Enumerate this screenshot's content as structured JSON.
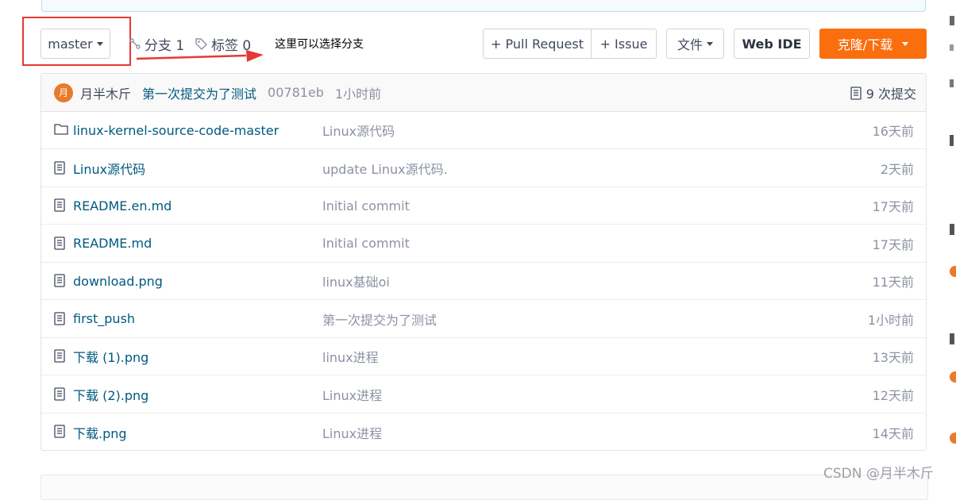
{
  "toolbar": {
    "branch": "master",
    "branches_label": "分支 1",
    "tags_label": "标签 0",
    "annotation": "这里可以选择分支",
    "pull_request": "+ Pull Request",
    "issue": "+ Issue",
    "file_menu": "文件",
    "web_ide": "Web IDE",
    "clone": "克隆/下载"
  },
  "commit": {
    "avatar_letter": "月",
    "author": "月半木斤",
    "message": "第一次提交为了测试",
    "hash": "00781eb",
    "time": "1小时前",
    "count": "9 次提交"
  },
  "files": [
    {
      "type": "folder",
      "name": "linux-kernel-source-code-master",
      "message": "Linux源代码",
      "time": "16天前"
    },
    {
      "type": "file",
      "name": "Linux源代码",
      "message": "update Linux源代码.",
      "time": "2天前"
    },
    {
      "type": "file",
      "name": "README.en.md",
      "message": "Initial commit",
      "time": "17天前"
    },
    {
      "type": "file",
      "name": "README.md",
      "message": "Initial commit",
      "time": "17天前"
    },
    {
      "type": "file",
      "name": "download.png",
      "message": "linux基础oi",
      "time": "11天前"
    },
    {
      "type": "file",
      "name": "first_push",
      "message": "第一次提交为了测试",
      "time": "1小时前"
    },
    {
      "type": "file",
      "name": "下载 (1).png",
      "message": "linux进程",
      "time": "13天前"
    },
    {
      "type": "file",
      "name": "下载 (2).png",
      "message": "Linux进程",
      "time": "12天前"
    },
    {
      "type": "file",
      "name": "下载.png",
      "message": "Linux进程",
      "time": "14天前"
    }
  ],
  "watermark": "CSDN @月半木斤",
  "colors": {
    "accent_orange": "#fa6e0e",
    "link_blue": "#005980",
    "highlight_red": "#e53935",
    "avatar_orange": "#e87a2a"
  }
}
